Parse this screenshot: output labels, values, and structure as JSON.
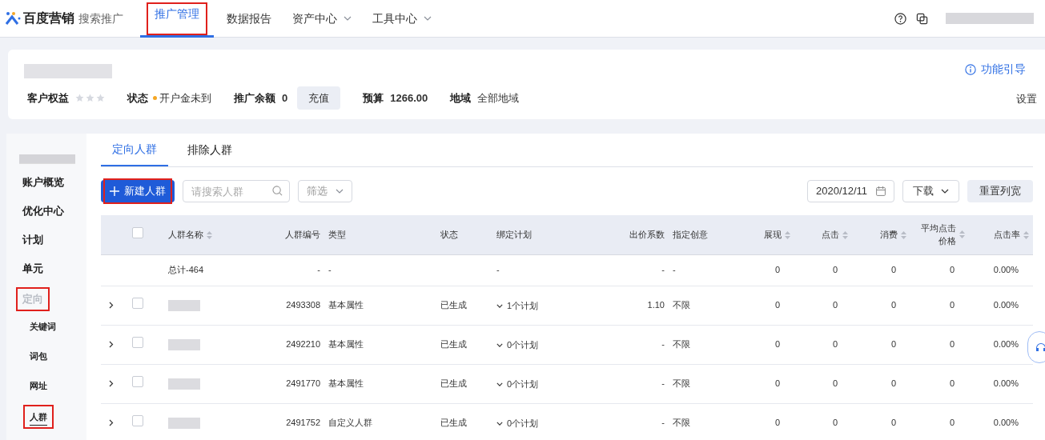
{
  "brand": {
    "name": "百度营销",
    "product": "搜索推广"
  },
  "nav": [
    {
      "label": "推广管理",
      "selected": true,
      "highlighted": true,
      "dropdown": false
    },
    {
      "label": "数据报告",
      "selected": false,
      "highlighted": false,
      "dropdown": false
    },
    {
      "label": "资产中心",
      "selected": false,
      "highlighted": false,
      "dropdown": true
    },
    {
      "label": "工具中心",
      "selected": false,
      "highlighted": false,
      "dropdown": true
    }
  ],
  "account": {
    "guide": "功能引导",
    "rights_label": "客户权益",
    "stars": 0,
    "status_label": "状态",
    "status": "开户金未到",
    "balance_label": "推广余额",
    "balance": "0",
    "recharge": "充值",
    "budget_label": "预算",
    "budget": "1266.00",
    "region_label": "地域",
    "region": "全部地域",
    "settings": "设置"
  },
  "sidebar": {
    "items": [
      {
        "label": "账户概览",
        "highlighted": false,
        "selected": false
      },
      {
        "label": "优化中心",
        "highlighted": false,
        "selected": false
      },
      {
        "label": "计划",
        "highlighted": false,
        "selected": false
      },
      {
        "label": "单元",
        "highlighted": false,
        "selected": false
      },
      {
        "label": "定向",
        "highlighted": true,
        "selected": false,
        "children": [
          {
            "label": "关键词",
            "highlighted": false,
            "selected": false
          },
          {
            "label": "词包",
            "highlighted": false,
            "selected": false
          },
          {
            "label": "网址",
            "highlighted": false,
            "selected": false
          },
          {
            "label": "人群",
            "highlighted": true,
            "selected": true
          }
        ]
      }
    ]
  },
  "tabs": [
    {
      "label": "定向人群",
      "selected": true
    },
    {
      "label": "排除人群",
      "selected": false
    }
  ],
  "toolbar": {
    "new_button": "新建人群",
    "new_highlighted": true,
    "search_placeholder": "请搜索人群",
    "filter": "筛选",
    "date": "2020/12/11",
    "download": "下载",
    "reset": "重置列宽"
  },
  "table": {
    "all_checked": false,
    "columns": [
      {
        "label": "人群名称",
        "sortable": true
      },
      {
        "label": "人群编号",
        "sortable": false
      },
      {
        "label": "类型",
        "sortable": false
      },
      {
        "label": "状态",
        "sortable": false
      },
      {
        "label": "绑定计划",
        "sortable": false
      },
      {
        "label": "出价系数",
        "sortable": false
      },
      {
        "label": "指定创意",
        "sortable": false
      },
      {
        "label": "展现",
        "sortable": true
      },
      {
        "label": "点击",
        "sortable": true
      },
      {
        "label": "消费",
        "sortable": true
      },
      {
        "label": "平均点击价格",
        "sortable": true
      },
      {
        "label": "点击率",
        "sortable": true
      }
    ],
    "total": {
      "name": "总计-464",
      "id": "-",
      "type": "-",
      "plans": "-",
      "bid": "-",
      "creative": "-",
      "values": [
        "0",
        "0",
        "0",
        "0",
        "0.00%"
      ]
    },
    "rows": [
      {
        "id": "2493308",
        "type": "基本属性",
        "status": "已生成",
        "plans": "1个计划",
        "bid": "1.10",
        "creative": "不限",
        "values": [
          "0",
          "0",
          "0",
          "0",
          "0.00%"
        ],
        "checked": false
      },
      {
        "id": "2492210",
        "type": "基本属性",
        "status": "已生成",
        "plans": "0个计划",
        "bid": "-",
        "creative": "不限",
        "values": [
          "0",
          "0",
          "0",
          "0",
          "0.00%"
        ],
        "checked": false
      },
      {
        "id": "2491770",
        "type": "基本属性",
        "status": "已生成",
        "plans": "0个计划",
        "bid": "-",
        "creative": "不限",
        "values": [
          "0",
          "0",
          "0",
          "0",
          "0.00%"
        ],
        "checked": false
      },
      {
        "id": "2491752",
        "type": "自定义人群",
        "status": "已生成",
        "plans": "0个计划",
        "bid": "-",
        "creative": "不限",
        "values": [
          "0",
          "0",
          "0",
          "0",
          "0.00%"
        ],
        "checked": false
      }
    ]
  }
}
